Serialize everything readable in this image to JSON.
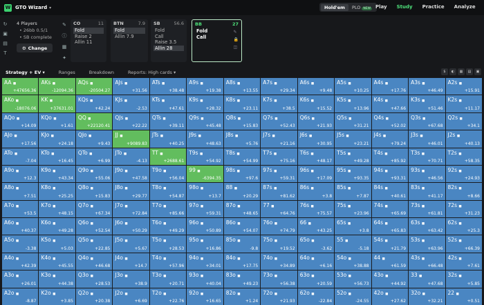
{
  "header": {
    "logo": "W",
    "title": "GTO Wizard",
    "modes": [
      "Hold'em",
      "PLO"
    ],
    "new_badge": "NEW",
    "nav": [
      "Play",
      "Study",
      "Practice",
      "Analyze"
    ]
  },
  "players": {
    "title": "4 Players",
    "stack": "26bb 0.5/1",
    "status": "SB complete",
    "change_label": "Change"
  },
  "positions": [
    {
      "name": "CO",
      "stack": "11",
      "actions": [
        "Fold",
        "Raise 2",
        "Allin 11"
      ],
      "selected": 0
    },
    {
      "name": "BTN",
      "stack": "7.9",
      "actions": [
        "Fold",
        "Allin 7.9"
      ],
      "selected": 0
    },
    {
      "name": "SB",
      "stack": "56.6",
      "actions": [
        "Fold",
        "Call",
        "Raise 3.5",
        "Allin 28"
      ],
      "selected": 3
    },
    {
      "name": "BB",
      "stack": "27",
      "actions": [
        "Fold",
        "Call"
      ],
      "selected": -1
    }
  ],
  "tabs": [
    "Strategy + EV",
    "Ranges",
    "Breakdown",
    "Reports: High cards"
  ],
  "hand_grid": [
    [
      [
        "AA",
        "+47656.36"
      ],
      [
        "AKs",
        "-12094.36"
      ],
      [
        "AQs",
        "-20504.27"
      ],
      [
        "AJs",
        "+31.56"
      ],
      [
        "ATs",
        "+38.48"
      ],
      [
        "A9s",
        "+19.38"
      ],
      [
        "A8s",
        "+13.55"
      ],
      [
        "A7s",
        "+29.34"
      ],
      [
        "A6s",
        "+9.48"
      ],
      [
        "A5s",
        "+10.25"
      ],
      [
        "A4s",
        "+17.76"
      ],
      [
        "A3s",
        "+46.49"
      ],
      [
        "A2s",
        "+15.91"
      ]
    ],
    [
      [
        "AKo",
        "-18076.06"
      ],
      [
        "KK",
        "+37631.01"
      ],
      [
        "KQs",
        "+42.24"
      ],
      [
        "KJs",
        "-2.53"
      ],
      [
        "KTs",
        "+47.61"
      ],
      [
        "K9s",
        "+28.32"
      ],
      [
        "K8s",
        "+23.11"
      ],
      [
        "K7s",
        "+38.5"
      ],
      [
        "K6s",
        "+15.52"
      ],
      [
        "K5s",
        "+13.96"
      ],
      [
        "K4s",
        "+47.66"
      ],
      [
        "K3s",
        "+51.46"
      ],
      [
        "K2s",
        "+11.17"
      ]
    ],
    [
      [
        "AQo",
        "+14.09"
      ],
      [
        "KQo",
        "+1.61"
      ],
      [
        "QQ",
        "+22120.41"
      ],
      [
        "QJs",
        "+22.22"
      ],
      [
        "QTs",
        "+39.11"
      ],
      [
        "Q9s",
        "+45.48"
      ],
      [
        "Q8s",
        "+15.83"
      ],
      [
        "Q7s",
        "+52.43"
      ],
      [
        "Q6s",
        "+21.93"
      ],
      [
        "Q5s",
        "+31.21"
      ],
      [
        "Q4s",
        "+52.02"
      ],
      [
        "Q3s",
        "+67.68"
      ],
      [
        "Q2s",
        "+34.1"
      ]
    ],
    [
      [
        "AJo",
        "+17.56"
      ],
      [
        "KJo",
        "+24.18"
      ],
      [
        "QJo",
        "+9.43"
      ],
      [
        "JJ",
        "+9089.83"
      ],
      [
        "JTs",
        "+40.25"
      ],
      [
        "J9s",
        "+48.63"
      ],
      [
        "J8s",
        "+5.76"
      ],
      [
        "J7s",
        "+21.16"
      ],
      [
        "J6s",
        "+30.95"
      ],
      [
        "J5s",
        "+23.21"
      ],
      [
        "J4s",
        "+79.24"
      ],
      [
        "J3s",
        "+46.01"
      ],
      [
        "J2s",
        "+40.13"
      ]
    ],
    [
      [
        "ATo",
        "-7.04"
      ],
      [
        "KTo",
        "+16.45"
      ],
      [
        "QTo",
        "+6.99"
      ],
      [
        "JTo",
        "-4.13"
      ],
      [
        "TT",
        "+2688.61"
      ],
      [
        "T9s",
        "+54.92"
      ],
      [
        "T8s",
        "+54.99"
      ],
      [
        "T7s",
        "+75.16"
      ],
      [
        "T6s",
        "+48.17"
      ],
      [
        "T5s",
        "+49.28"
      ],
      [
        "T4s",
        "+85.92"
      ],
      [
        "T3s",
        "+70.71"
      ],
      [
        "T2s",
        "+58.35"
      ]
    ],
    [
      [
        "A9o",
        "+12.3"
      ],
      [
        "K9o",
        "+43.34"
      ],
      [
        "Q9o",
        "+55.06"
      ],
      [
        "J9o",
        "+47.58"
      ],
      [
        "T9o",
        "+56.04"
      ],
      [
        "99",
        "-6394.35"
      ],
      [
        "98s",
        "+97.6"
      ],
      [
        "97s",
        "+59.31"
      ],
      [
        "96s",
        "+17.09"
      ],
      [
        "95s",
        "+93.35"
      ],
      [
        "94s",
        "+93.31"
      ],
      [
        "93s",
        "+46.56"
      ],
      [
        "92s",
        "+24.93"
      ]
    ],
    [
      [
        "A8o",
        "+7.51"
      ],
      [
        "K8o",
        "+25.25"
      ],
      [
        "Q8o",
        "+15.83"
      ],
      [
        "J8o",
        "+29.77"
      ],
      [
        "T8o",
        "+54.87"
      ],
      [
        "98o",
        "+13.7"
      ],
      [
        "88",
        "+20.29"
      ],
      [
        "87s",
        "+81.62"
      ],
      [
        "86s",
        "+3.8"
      ],
      [
        "85s",
        "+7.87"
      ],
      [
        "84s",
        "+40.61"
      ],
      [
        "83s",
        "+41.17"
      ],
      [
        "82s",
        "+8.66"
      ]
    ],
    [
      [
        "A7o",
        "+53.5"
      ],
      [
        "K7o",
        "+48.15"
      ],
      [
        "Q7o",
        "+67.34"
      ],
      [
        "J7o",
        "+72.84"
      ],
      [
        "T7o",
        "+85.66"
      ],
      [
        "97o",
        "+59.31"
      ],
      [
        "87o",
        "+48.65"
      ],
      [
        "77",
        "+64.76"
      ],
      [
        "76s",
        "+75.57"
      ],
      [
        "75s",
        "+23.96"
      ],
      [
        "74s",
        "+65.69"
      ],
      [
        "73s",
        "+61.81"
      ],
      [
        "72s",
        "+31.23"
      ]
    ],
    [
      [
        "A6o",
        "+40.37"
      ],
      [
        "K6o",
        "+49.28"
      ],
      [
        "Q6o",
        "+52.54"
      ],
      [
        "J6o",
        "+50.29"
      ],
      [
        "T6o",
        "+49.29"
      ],
      [
        "96o",
        "+50.89"
      ],
      [
        "86o",
        "+54.07"
      ],
      [
        "76o",
        "+74.79"
      ],
      [
        "66",
        "+43.25"
      ],
      [
        "65s",
        "+3.8"
      ],
      [
        "64s",
        "+65.83"
      ],
      [
        "63s",
        "+63.42"
      ],
      [
        "62s",
        "+25.3"
      ]
    ],
    [
      [
        "A5o",
        "-3.38"
      ],
      [
        "K5o",
        "+5.03"
      ],
      [
        "Q5o",
        "+22.85"
      ],
      [
        "J5o",
        "+5.67"
      ],
      [
        "T5o",
        "+28.53"
      ],
      [
        "95o",
        "+16.86"
      ],
      [
        "85o",
        "-9.8"
      ],
      [
        "75o",
        "+19.52"
      ],
      [
        "65o",
        "-3.62"
      ],
      [
        "55",
        "-5.18"
      ],
      [
        "54s",
        "+21.79"
      ],
      [
        "53s",
        "+63.96"
      ],
      [
        "52s",
        "+66.39"
      ]
    ],
    [
      [
        "A4o",
        "+42.39"
      ],
      [
        "K4o",
        "+45.55"
      ],
      [
        "Q4o",
        "+46.68"
      ],
      [
        "J4o",
        "+14.7"
      ],
      [
        "T4o",
        "+57.96"
      ],
      [
        "94o",
        "+34.01"
      ],
      [
        "84o",
        "+17.75"
      ],
      [
        "74o",
        "+34.89"
      ],
      [
        "64o",
        "+6.16"
      ],
      [
        "54o",
        "+38.88"
      ],
      [
        "44",
        "+61.59"
      ],
      [
        "43s",
        "+66.48"
      ],
      [
        "42s",
        "+7.61"
      ]
    ],
    [
      [
        "A3o",
        "+26.01"
      ],
      [
        "K3o",
        "+44.38"
      ],
      [
        "Q3o",
        "+28.53"
      ],
      [
        "J3o",
        "+38.9"
      ],
      [
        "T3o",
        "+20.71"
      ],
      [
        "93o",
        "+40.04"
      ],
      [
        "83o",
        "+49.23"
      ],
      [
        "73o",
        "+56.38"
      ],
      [
        "63o",
        "+20.59"
      ],
      [
        "53o",
        "+56.73"
      ],
      [
        "43o",
        "+44.92"
      ],
      [
        "33",
        "+47.68"
      ],
      [
        "32s",
        "+5.85"
      ]
    ],
    [
      [
        "A2o",
        "-8.87"
      ],
      [
        "K2o",
        "+3.85"
      ],
      [
        "Q2o",
        "+20.38"
      ],
      [
        "J2o",
        "+6.69"
      ],
      [
        "T2o",
        "+22.76"
      ],
      [
        "92o",
        "+16.65"
      ],
      [
        "82o",
        "+1.24"
      ],
      [
        "72o",
        "+21.93"
      ],
      [
        "62o",
        "-22.84"
      ],
      [
        "52o",
        "-24.55"
      ],
      [
        "42o",
        "+27.62"
      ],
      [
        "32o",
        "+32.21"
      ],
      [
        "22",
        "+0.51"
      ]
    ]
  ],
  "green_cells": [
    "AA",
    "AKs",
    "AQs",
    "AKo",
    "KK",
    "QQ",
    "JJ",
    "TT",
    "99"
  ]
}
